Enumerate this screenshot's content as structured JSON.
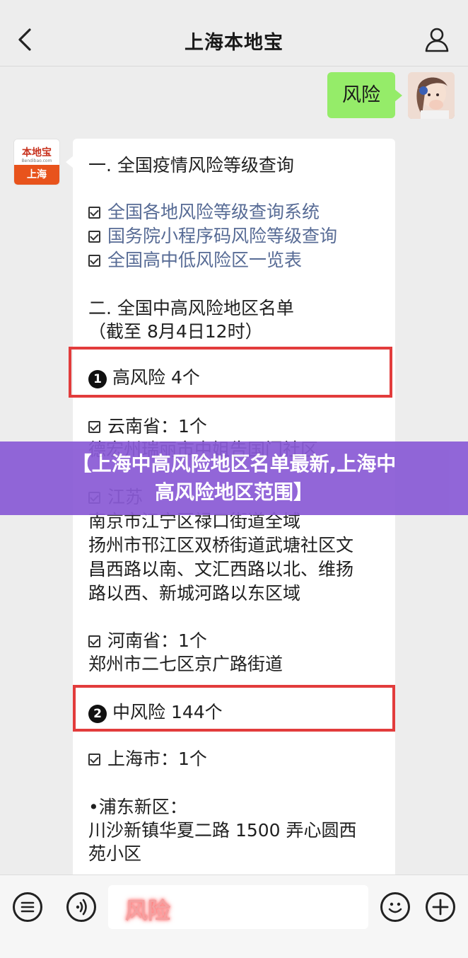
{
  "header": {
    "title": "上海本地宝"
  },
  "user_message": {
    "text": "风险"
  },
  "bot": {
    "avatar_top": "本地宝",
    "avatar_domain": "Bendibao.com",
    "avatar_city": "上海"
  },
  "article": {
    "section1_title": "一. 全国疫情风险等级查询",
    "links": [
      "全国各地风险等级查询系统",
      "国务院小程序码风险等级查询",
      "全国高中低风险区一览表"
    ],
    "section2_title": "二. 全国中高风险地区名单",
    "section2_date": "（截至 8月4日12时）",
    "high_risk": {
      "num": "1",
      "label": "高风险 4个"
    },
    "yunnan": {
      "province": "云南省：1个",
      "area": "德宏州瑞丽市中姐告国门社区"
    },
    "jiangsu": {
      "province": "江苏",
      "areas": [
        "南京市江宁区禄口街道全域",
        "扬州市邗江区双桥街道武塘社区文",
        "昌西路以南、文汇西路以北、维扬",
        "路以西、新城河路以东区域"
      ]
    },
    "henan": {
      "province": "河南省：1个",
      "area": "郑州市二七区京广路街道"
    },
    "mid_risk": {
      "num": "2",
      "label": "中风险 144个"
    },
    "shanghai": {
      "province": "上海市：1个",
      "district": "•浦东新区：",
      "areas": [
        "川沙新镇华夏二路 1500 弄心圆西",
        "苑小区"
      ]
    }
  },
  "banner": {
    "line1": "【上海中高风险地区名单最新,上海中",
    "line2": "高风险地区范围】"
  },
  "input": {
    "value": "风险"
  },
  "colors": {
    "user_bubble": "#95ec69",
    "link": "#576b95",
    "highlight_box": "#e23c3c",
    "banner": "#8a5bd6"
  },
  "icons": [
    "back-arrow-icon",
    "person-icon",
    "menu-icon",
    "voice-icon",
    "emoji-icon",
    "plus-icon"
  ]
}
